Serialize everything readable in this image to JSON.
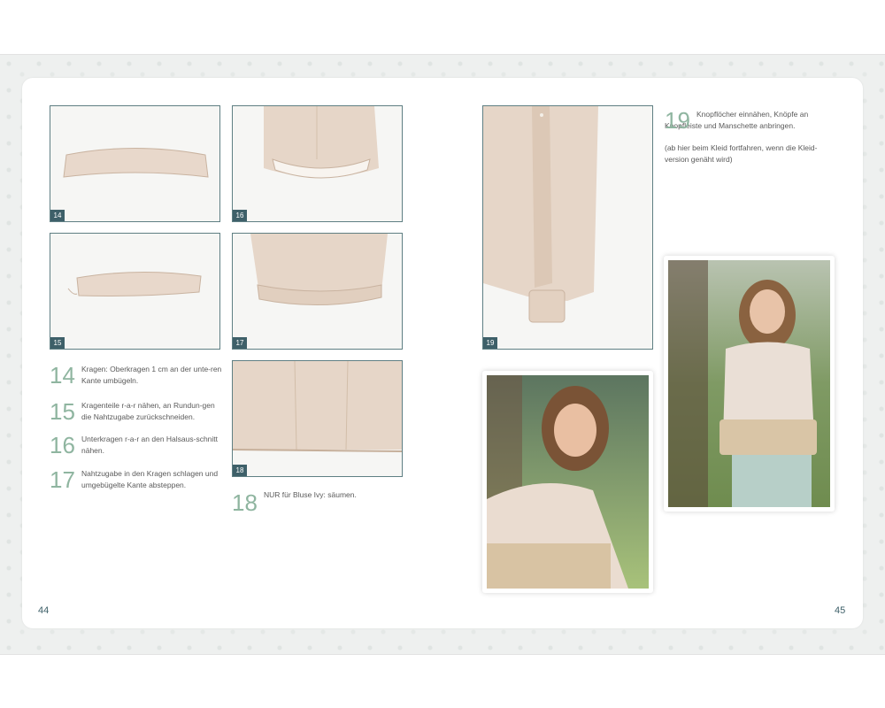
{
  "page_left": {
    "number": "44",
    "photos": [
      {
        "badge": "14"
      },
      {
        "badge": "16"
      },
      {
        "badge": "15"
      },
      {
        "badge": "17"
      },
      {
        "badge": "18"
      }
    ],
    "steps": [
      {
        "num": "14",
        "text": "Kragen: Oberkragen 1 cm an der unte-ren Kante umbügeln."
      },
      {
        "num": "15",
        "text": "Kragenteile r-a-r nähen, an Rundun-gen die Nahtzugabe zurückschneiden."
      },
      {
        "num": "16",
        "text": "Unterkragen r-a-r an den Halsaus-schnitt nähen."
      },
      {
        "num": "17",
        "text": "Nahtzugabe in den Kragen schlagen und umgebügelte Kante absteppen."
      },
      {
        "num": "18",
        "text": "NUR für Bluse Ivy: säumen."
      }
    ]
  },
  "page_right": {
    "number": "45",
    "photo": {
      "badge": "19"
    },
    "step": {
      "num": "19",
      "text": "Knopflöcher einnähen, Knöpfe an Knopfleiste und Manschette anbringen.",
      "note": "(ab hier beim Kleid fortfahren, wenn die Kleid-version genäht wird)"
    }
  },
  "colors": {
    "accent_number": "#8fb5a0",
    "badge": "#3e6069",
    "fabric": "#e6d6c8"
  }
}
